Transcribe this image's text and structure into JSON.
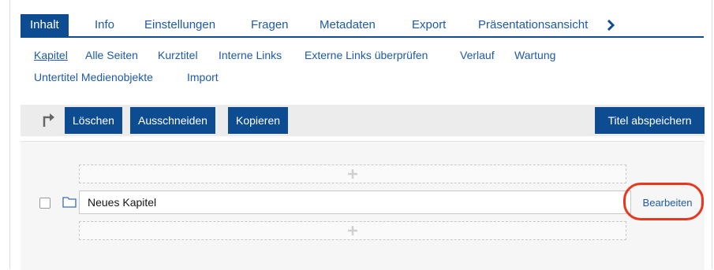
{
  "tabs": [
    {
      "label": "Inhalt",
      "active": true
    },
    {
      "label": "Info"
    },
    {
      "label": "Einstellungen"
    },
    {
      "label": "Fragen"
    },
    {
      "label": "Metadaten"
    },
    {
      "label": "Export"
    },
    {
      "label": "Präsentationsansicht"
    }
  ],
  "tab_more_icon": "chevron-right-icon",
  "subtabs": [
    {
      "label": "Kapitel",
      "current": true
    },
    {
      "label": "Alle Seiten"
    },
    {
      "label": "Kurztitel"
    },
    {
      "label": "Interne Links"
    },
    {
      "label": "Externe Links überprüfen"
    },
    {
      "label": "Verlauf"
    },
    {
      "label": "Wartung"
    },
    {
      "label": "Untertitel Medienobjekte"
    },
    {
      "label": "Import"
    }
  ],
  "toolbar": {
    "icon": "arrow-turn-icon",
    "delete_label": "Löschen",
    "cut_label": "Ausschneiden",
    "copy_label": "Kopieren",
    "save_titles_label": "Titel abspeichern"
  },
  "chapter": {
    "checkbox_checked": false,
    "folder_icon": "folder-icon",
    "title_value": "Neues Kapitel",
    "edit_label": "Bearbeiten"
  },
  "insert_icon": "plus-icon",
  "colors": {
    "primary": "#0e4c92",
    "link": "#1e5aa8",
    "highlight": "#e8371f"
  }
}
